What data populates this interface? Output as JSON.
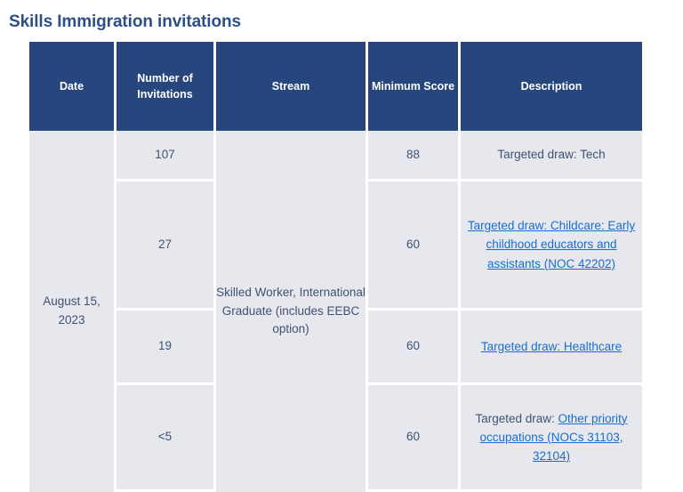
{
  "page": {
    "title": "Skills Immigration invitations",
    "title_color": "#2d4f87",
    "header_bg": "#27467d",
    "cell_bg": "#e7e8ee",
    "text_color": "#3f5273",
    "link_color": "#1a6dcf"
  },
  "table": {
    "columns": [
      {
        "key": "date",
        "label": "Date"
      },
      {
        "key": "number",
        "label": "Number of Invitations"
      },
      {
        "key": "stream",
        "label": "Stream"
      },
      {
        "key": "score",
        "label": "Minimum Score"
      },
      {
        "key": "desc",
        "label": "Description"
      }
    ],
    "date_value": "August 15, 2023",
    "stream_value": "Skilled Worker, International Graduate (includes EEBC option)",
    "rows": [
      {
        "number": "107",
        "score": "88",
        "description_plain": "Targeted draw: Tech",
        "description_prefix": "",
        "description_link": ""
      },
      {
        "number": "27",
        "score": "60",
        "description_plain": "",
        "description_prefix": "",
        "description_link": "Targeted draw: Childcare: Early childhood educators and assistants (NOC 42202)"
      },
      {
        "number": "19",
        "score": "60",
        "description_plain": "",
        "description_prefix": "",
        "description_link": "Targeted draw: Healthcare"
      },
      {
        "number": "<5",
        "score": "60",
        "description_plain": "",
        "description_prefix": "Targeted draw: ",
        "description_link": "Other priority occupations (NOCs 31103, 32104)"
      }
    ]
  }
}
